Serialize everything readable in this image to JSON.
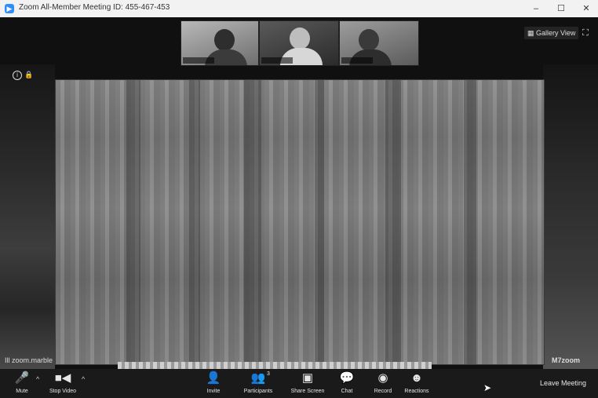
{
  "window": {
    "title": "Zoom All-Member Meeting ID: 455-467-453",
    "app_icon": "camera-icon",
    "minimize": "–",
    "maximize": "☐",
    "close": "✕"
  },
  "view": {
    "gallery_label": "Gallery View",
    "gallery_icon": "grid-icon",
    "fullscreen_glyph": "⛶"
  },
  "meeting_info": {
    "info_glyph": "i",
    "lock_glyph": "🔒"
  },
  "sharing": {
    "speaker_label": "Ill zoom.marble",
    "brand_mark": "M7zoom"
  },
  "toolbar": {
    "mute": {
      "label": "Mute",
      "icon": "microphone-icon",
      "glyph": "🎤"
    },
    "video": {
      "label": "Stop Video",
      "icon": "video-camera-icon",
      "glyph": "■◀"
    },
    "invite": {
      "label": "Invite",
      "icon": "add-person-icon",
      "glyph": "👤"
    },
    "participants": {
      "label": "Participants",
      "icon": "people-icon",
      "glyph": "👥",
      "count": "3"
    },
    "share": {
      "label": "Share Screen",
      "icon": "share-screen-icon",
      "glyph": "▣"
    },
    "chat": {
      "label": "Chat",
      "icon": "chat-bubble-icon",
      "glyph": "💬"
    },
    "record": {
      "label": "Record",
      "icon": "record-icon",
      "glyph": "◉"
    },
    "reactions": {
      "label": "Reactions",
      "icon": "emoji-icon",
      "glyph": "☻"
    },
    "caret": "^",
    "leave": "Leave Meeting"
  },
  "colors": {
    "accent": "#2d8cff",
    "toolbar_bg": "#1a1a1a",
    "stage_bg": "#101010"
  }
}
